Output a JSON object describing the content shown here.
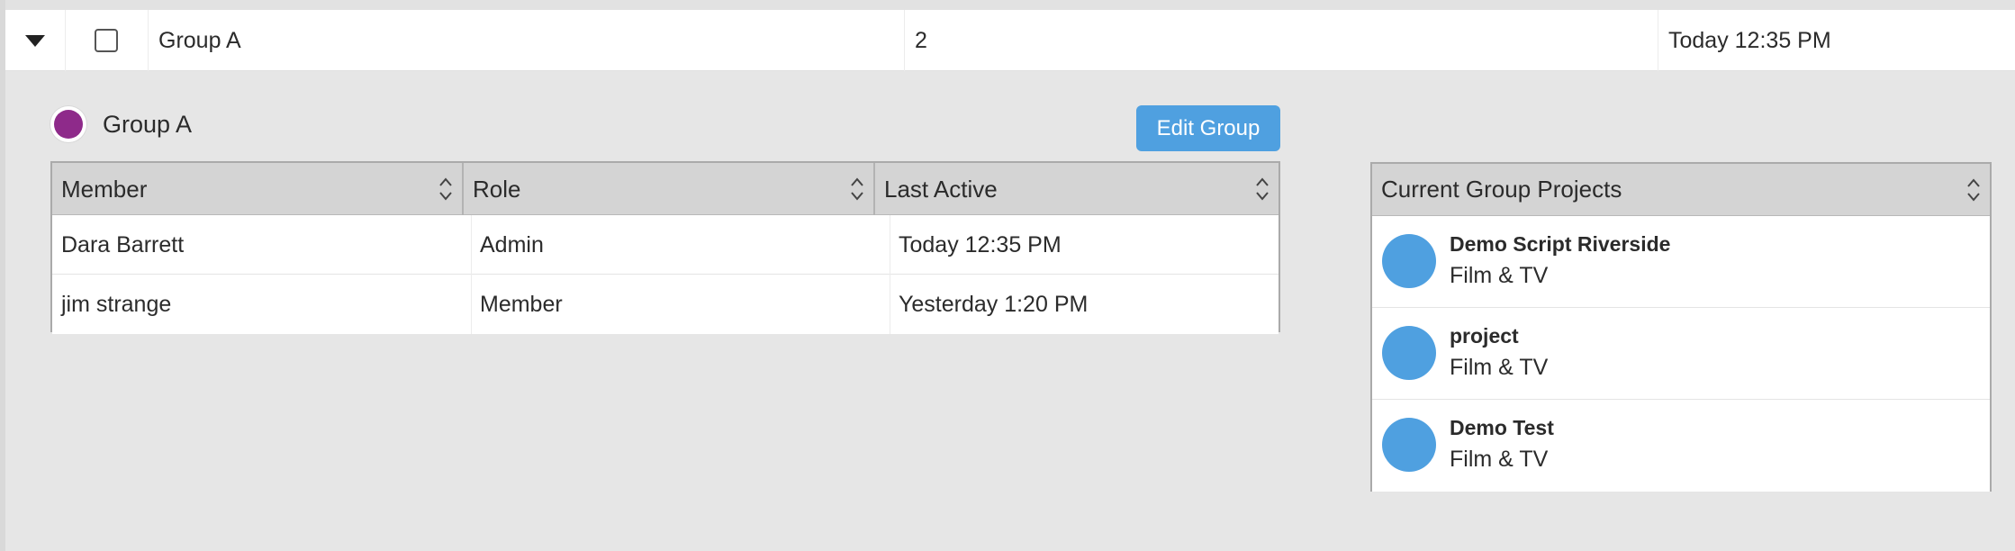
{
  "group_row": {
    "name": "Group A",
    "member_count": "2",
    "last_active": "Today 12:35 PM"
  },
  "details": {
    "group_name": "Group A",
    "group_color": "#8e2a8a",
    "edit_button_label": "Edit Group"
  },
  "members_table": {
    "columns": [
      "Member",
      "Role",
      "Last Active"
    ],
    "rows": [
      {
        "member": "Dara Barrett",
        "role": "Admin",
        "last_active": "Today 12:35 PM"
      },
      {
        "member": "jim strange",
        "role": "Member",
        "last_active": "Yesterday 1:20 PM"
      }
    ]
  },
  "projects": {
    "header": "Current Group Projects",
    "avatar_color": "#4fa0e0",
    "items": [
      {
        "title": "Demo Script Riverside",
        "category": "Film & TV"
      },
      {
        "title": "project",
        "category": "Film & TV"
      },
      {
        "title": "Demo Test",
        "category": "Film & TV"
      }
    ]
  },
  "colors": {
    "accent": "#4fa0e0",
    "header_bg": "#d4d4d4",
    "panel_bg": "#e6e6e6"
  },
  "icons": {
    "expand": "caret-down-icon",
    "sort": "sort-icon"
  }
}
